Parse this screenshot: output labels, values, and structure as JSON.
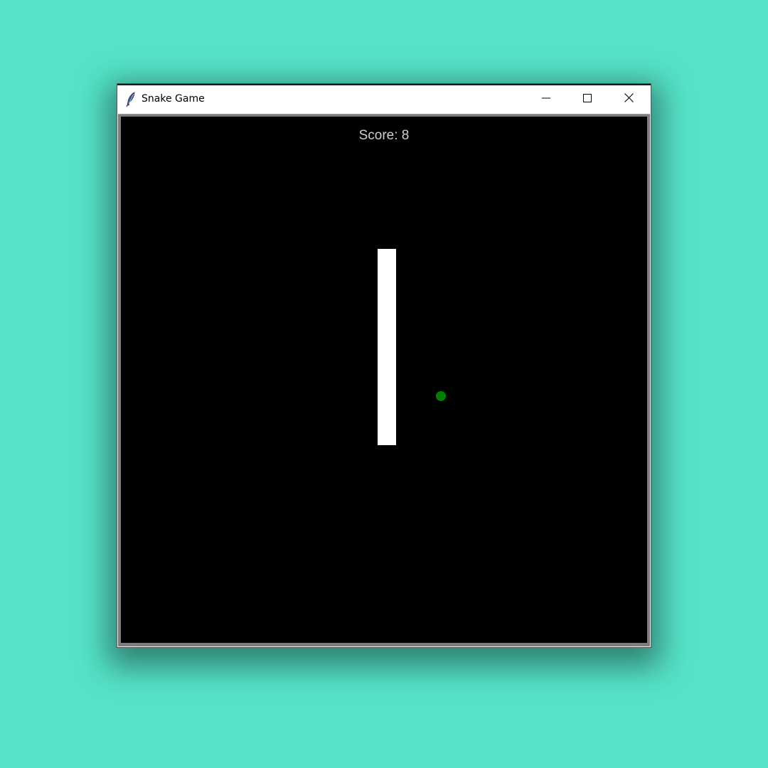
{
  "page": {
    "background_color": "#55e3c7"
  },
  "window": {
    "title": "Snake Game",
    "icon": "feather-icon",
    "controls": {
      "minimize_icon": "minimize-icon",
      "maximize_icon": "maximize-icon",
      "close_icon": "close-icon"
    }
  },
  "game": {
    "score_text": "Score: 8",
    "canvas_color": "#000000",
    "snake_color": "#ffffff",
    "food_color": "#008000",
    "score_color": "#cfcfcf"
  }
}
